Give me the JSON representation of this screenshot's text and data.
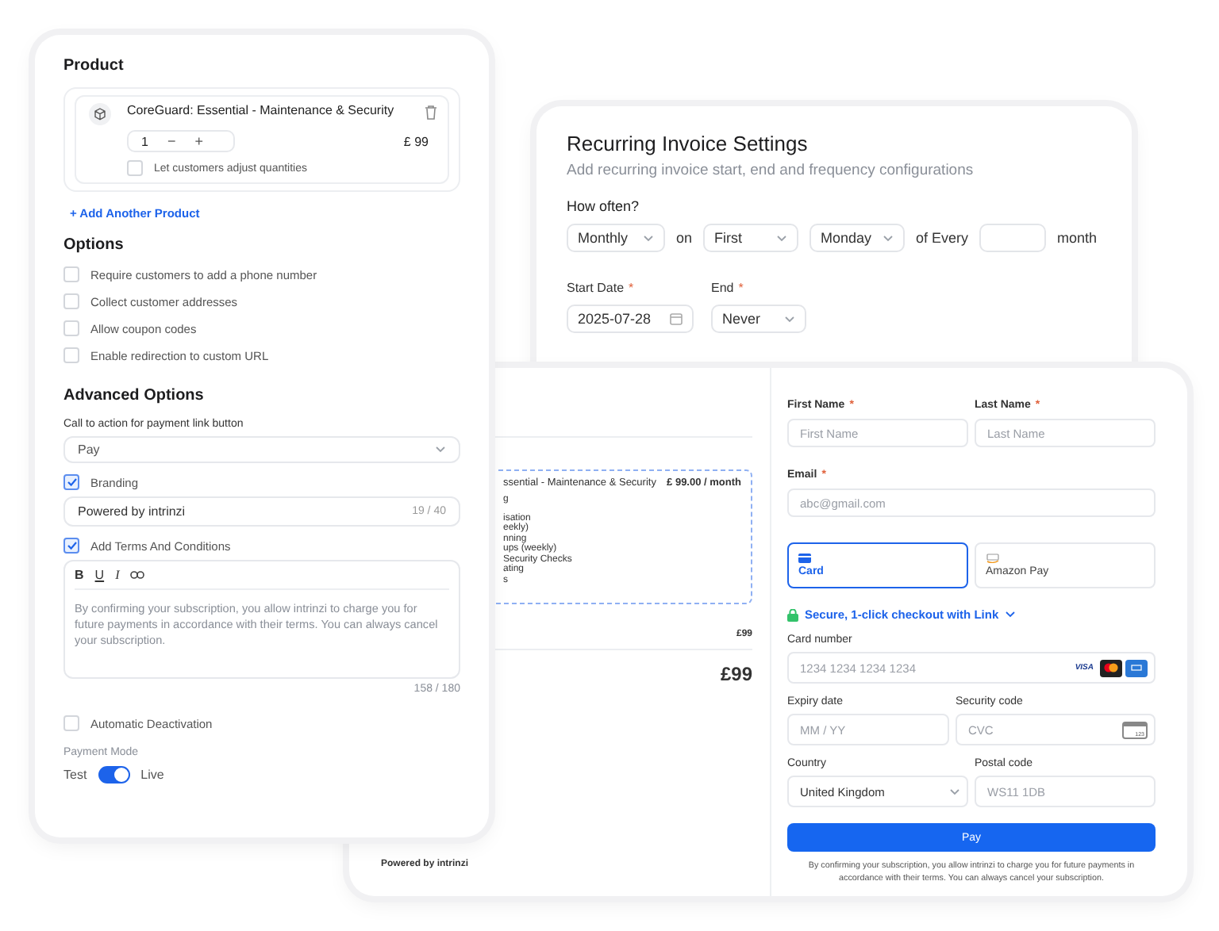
{
  "product_panel": {
    "title": "Product",
    "product": {
      "name": "CoreGuard: Essential - Maintenance & Security",
      "quantity": "1",
      "minus": "−",
      "plus": "+",
      "price": "£ 99",
      "adjust_label": "Let customers adjust quantities",
      "adjust_checked": false
    },
    "add_product": "+ Add Another Product",
    "options_title": "Options",
    "options": [
      {
        "label": "Require customers to add a phone number",
        "checked": false
      },
      {
        "label": "Collect customer addresses",
        "checked": false
      },
      {
        "label": "Allow coupon codes",
        "checked": false
      },
      {
        "label": "Enable redirection to custom URL",
        "checked": false
      }
    ],
    "advanced_title": "Advanced Options",
    "cta_label": "Call to action for payment link button",
    "cta_value": "Pay",
    "branding": {
      "label": "Branding",
      "checked": true,
      "value": "Powered by intrinzi",
      "count": "19 / 40"
    },
    "terms": {
      "label": "Add Terms And Conditions",
      "checked": true,
      "format_buttons": [
        {
          "kind": "bold",
          "text": "B"
        },
        {
          "kind": "underline",
          "text": "U"
        },
        {
          "kind": "italic",
          "text": "I"
        }
      ],
      "text": "By confirming your subscription, you allow intrinzi to charge you for future payments in accordance with their terms. You can always cancel your subscription.",
      "count": "158 / 180"
    },
    "auto_deactivation": {
      "label": "Automatic Deactivation",
      "checked": false
    },
    "payment_mode": {
      "label": "Payment Mode",
      "off_label": "Test",
      "on_label": "Live",
      "on": true
    }
  },
  "recurring": {
    "title": "Recurring Invoice Settings",
    "subtitle": "Add recurring invoice start, end and frequency configurations",
    "how_often": "How often?",
    "frequency_row": [
      {
        "kind": "select",
        "value": "Monthly"
      },
      {
        "kind": "text",
        "text": "on"
      },
      {
        "kind": "select",
        "value": "First"
      },
      {
        "kind": "select",
        "value": "Monday"
      },
      {
        "kind": "text",
        "text": "of Every"
      },
      {
        "kind": "input"
      },
      {
        "kind": "text",
        "text": "month"
      }
    ],
    "start_date": {
      "label": "Start Date",
      "required_mark": "*",
      "value": "2025-07-28"
    },
    "end": {
      "label": "End",
      "required_mark": "*",
      "value": "Never"
    }
  },
  "checkout": {
    "summary": {
      "product_name": "ssential - Maintenance & Security",
      "price": "£ 99.00 / month",
      "features": [
        "g",
        "isation",
        "eekly)",
        "nning",
        "ups (weekly)",
        "Security Checks",
        "ating",
        "s"
      ],
      "subtotal": "£99",
      "total": "£99",
      "powered_by": "Powered by intrinzi"
    },
    "first_name": {
      "label": "First Name",
      "required_mark": "*",
      "placeholder": "First Name"
    },
    "last_name": {
      "label": "Last Name",
      "required_mark": "*",
      "placeholder": "Last Name"
    },
    "email": {
      "label": "Email",
      "required_mark": "*",
      "placeholder": "abc@gmail.com"
    },
    "payment_methods": [
      {
        "kind": "card",
        "label": "Card",
        "selected": true
      },
      {
        "kind": "amazon",
        "label": "Amazon Pay",
        "selected": false
      }
    ],
    "link": "Secure, 1-click checkout with Link",
    "card_number": {
      "label": "Card number",
      "placeholder": "1234 1234 1234 1234",
      "visa": "VISA"
    },
    "expiry": {
      "label": "Expiry date",
      "placeholder": "MM / YY"
    },
    "security": {
      "label": "Security code",
      "placeholder": "CVC",
      "icon_text": "123"
    },
    "country": {
      "label": "Country",
      "value": "United Kingdom"
    },
    "postal": {
      "label": "Postal code",
      "placeholder": "WS11 1DB"
    },
    "pay": "Pay",
    "disclaimer": "By confirming your subscription, you allow intrinzi to charge you for future payments in accordance with their terms. You can always cancel your subscription."
  }
}
